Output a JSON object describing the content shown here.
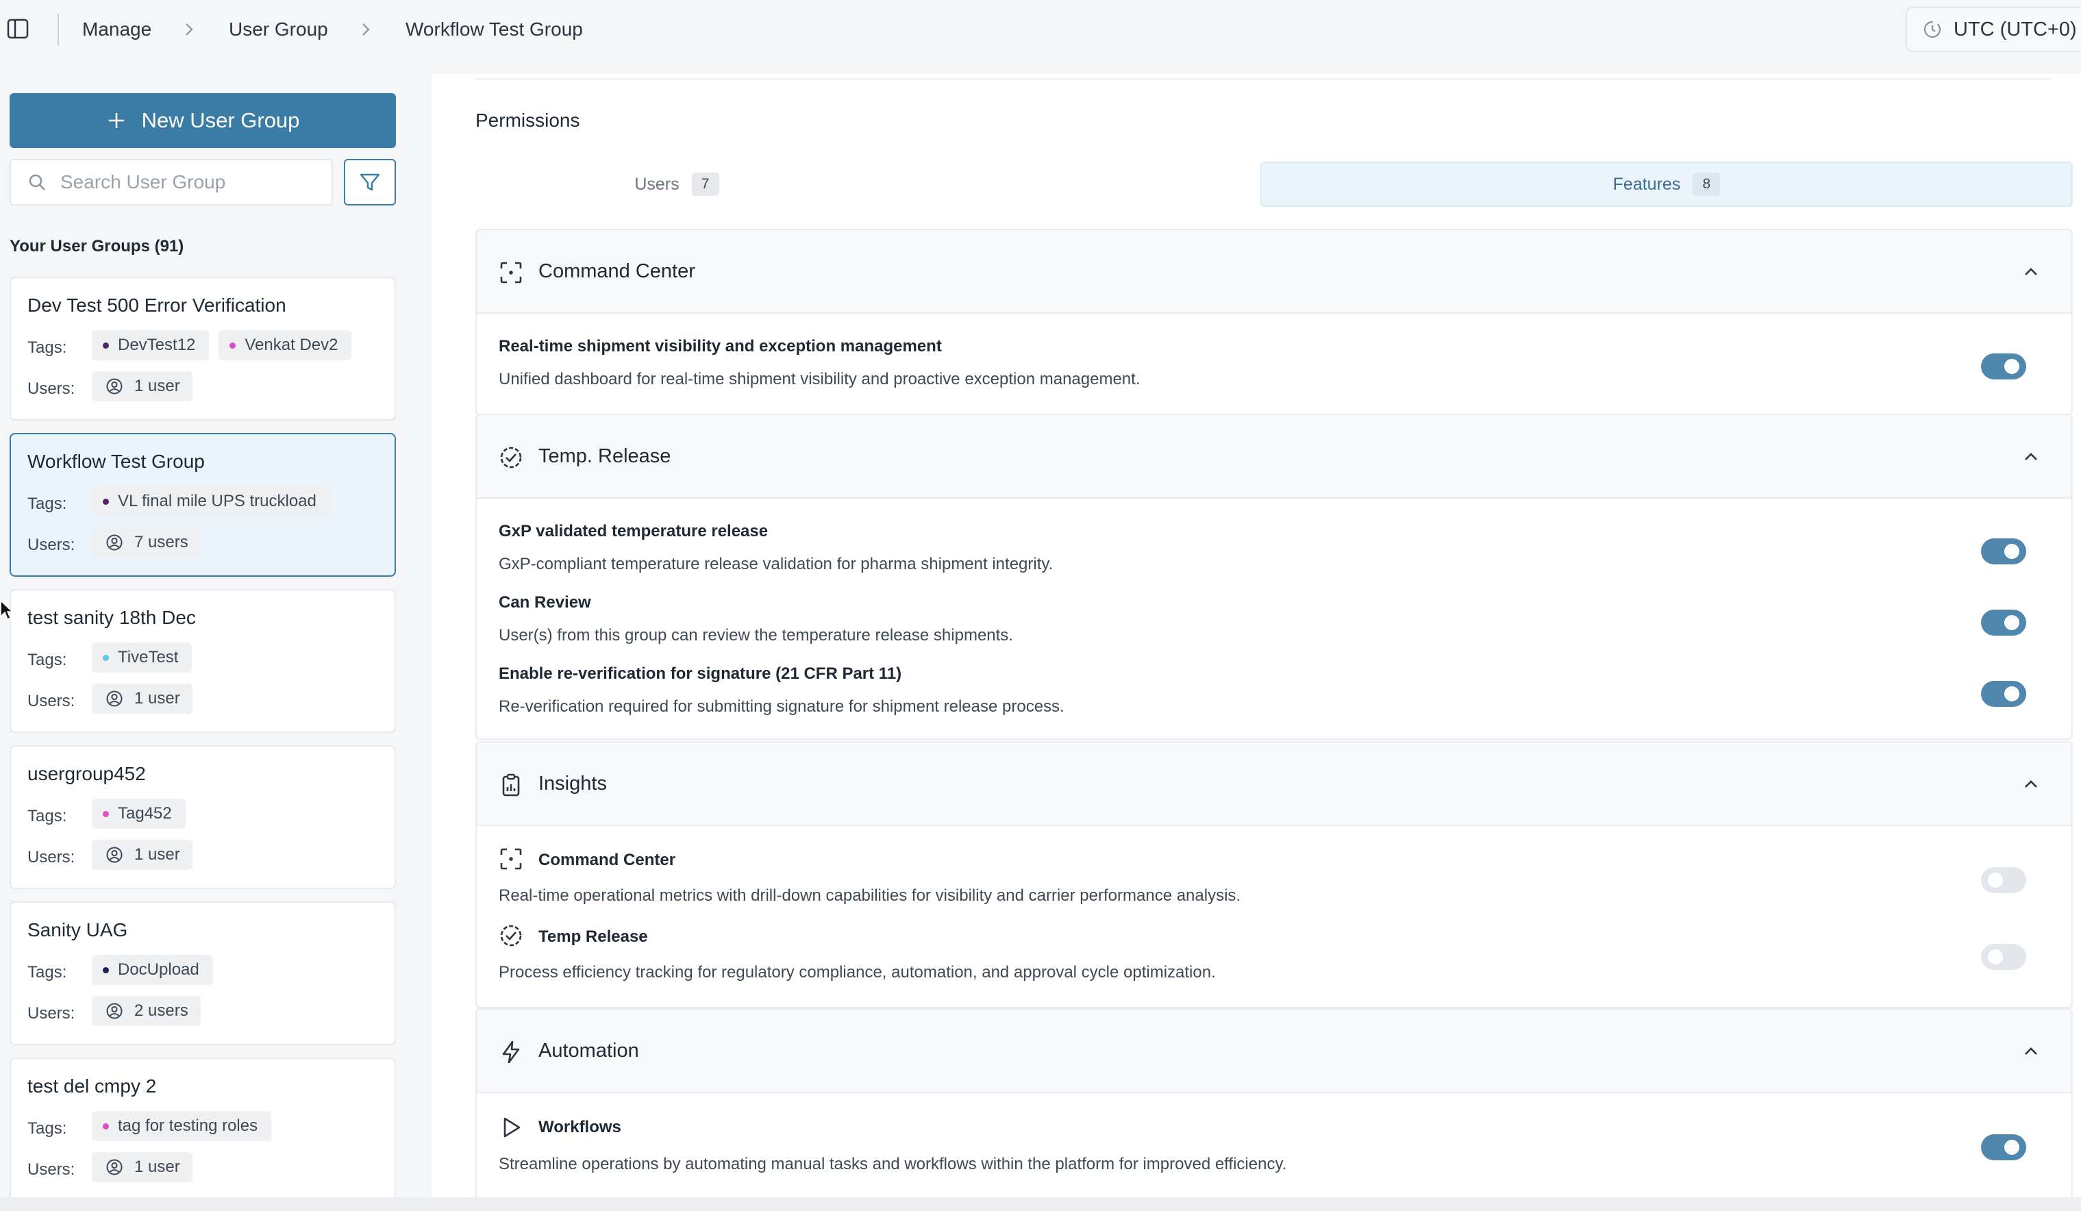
{
  "breadcrumb": [
    "Manage",
    "User Group",
    "Workflow Test Group"
  ],
  "timezone": "UTC (UTC+0)",
  "sidebar": {
    "new_button_label": "New User Group",
    "search_placeholder": "Search User Group",
    "groups_heading": "Your User Groups (91)",
    "tags_label": "Tags:",
    "users_label": "Users:",
    "groups": [
      {
        "name": "Dev Test 500 Error Verification",
        "tags": [
          {
            "label": "DevTest12",
            "color": "#4a2a6b"
          },
          {
            "label": "Venkat Dev2",
            "color": "#d64fc6"
          }
        ],
        "users": "1 user",
        "selected": false
      },
      {
        "name": "Workflow Test Group",
        "tags": [
          {
            "label": "VL final mile UPS truckload",
            "color": "#5a1f6b"
          }
        ],
        "users": "7 users",
        "selected": true
      },
      {
        "name": "test sanity 18th Dec",
        "tags": [
          {
            "label": "TiveTest",
            "color": "#5fc7e6"
          }
        ],
        "users": "1 user",
        "selected": false
      },
      {
        "name": "usergroup452",
        "tags": [
          {
            "label": "Tag452",
            "color": "#e24dbf"
          }
        ],
        "users": "1 user",
        "selected": false
      },
      {
        "name": "Sanity UAG",
        "tags": [
          {
            "label": "DocUpload",
            "color": "#1c1f5a"
          }
        ],
        "users": "2 users",
        "selected": false
      },
      {
        "name": "test del cmpy 2",
        "tags": [
          {
            "label": "tag for testing roles",
            "color": "#d64fc6"
          }
        ],
        "users": "1 user",
        "selected": false
      }
    ]
  },
  "permissions": {
    "title": "Permissions",
    "tabs": [
      {
        "label": "Users",
        "count": "7",
        "active": false
      },
      {
        "label": "Features",
        "count": "8",
        "active": true
      }
    ],
    "sections": {
      "command_center": {
        "title": "Command Center",
        "features": [
          {
            "title": "Real-time shipment visibility and exception management",
            "desc": "Unified dashboard for real-time shipment visibility and proactive exception management.",
            "enabled": true
          }
        ]
      },
      "temp_release": {
        "title": "Temp. Release",
        "features": [
          {
            "title": "GxP validated temperature release",
            "desc": "GxP-compliant temperature release validation for pharma shipment integrity.",
            "enabled": true
          },
          {
            "title": "Can Review",
            "desc": "User(s) from this group can review the temperature release shipments.",
            "enabled": true
          },
          {
            "title": "Enable re-verification for signature (21 CFR Part 11)",
            "desc": "Re-verification required for submitting signature for shipment release process.",
            "enabled": true
          }
        ]
      },
      "insights": {
        "title": "Insights",
        "features": [
          {
            "title": "Command Center",
            "desc": "Real-time operational metrics with drill-down capabilities for visibility and carrier performance analysis.",
            "enabled": false
          },
          {
            "title": "Temp Release",
            "desc": "Process efficiency tracking for regulatory compliance, automation, and approval cycle optimization.",
            "enabled": false
          }
        ]
      },
      "automation": {
        "title": "Automation",
        "features": [
          {
            "title": "Workflows",
            "desc": "Streamline operations by automating manual tasks and workflows within the platform for improved efficiency.",
            "enabled": true
          }
        ]
      }
    }
  }
}
